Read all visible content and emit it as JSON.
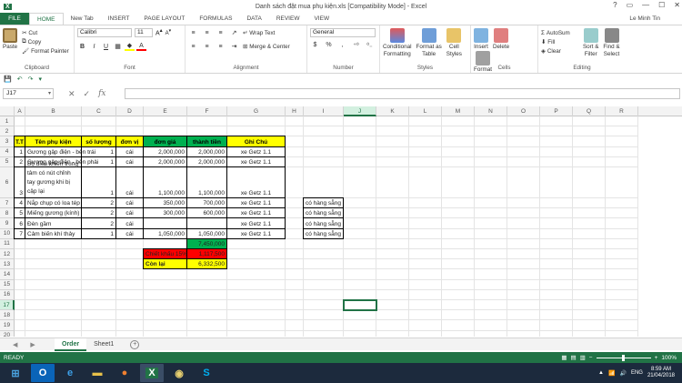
{
  "window": {
    "title": "Danh sách đặt mua phụ kiện.xls  [Compatibility Mode] - Excel",
    "controls": [
      "?",
      "▭",
      "—",
      "☐",
      "✕"
    ]
  },
  "tabs": [
    "FILE",
    "HOME",
    "New Tab",
    "INSERT",
    "PAGE LAYOUT",
    "FORMULAS",
    "DATA",
    "REVIEW",
    "VIEW"
  ],
  "active_tab": "HOME",
  "user": "Le Minh Tin",
  "ribbon": {
    "clipboard": {
      "paste": "Paste",
      "cut": "Cut",
      "copy": "Copy",
      "format_painter": "Format Painter",
      "label": "Clipboard"
    },
    "font": {
      "name": "Calibri",
      "size": "11",
      "label": "Font",
      "bold": "B",
      "italic": "I",
      "underline": "U"
    },
    "alignment": {
      "wrap": "Wrap Text",
      "merge": "Merge & Center",
      "label": "Alignment"
    },
    "number": {
      "format": "General",
      "label": "Number",
      "dollar": "$",
      "percent": "%",
      "comma": ","
    },
    "styles": {
      "conditional": "Conditional\nFormatting",
      "format_table": "Format as\nTable",
      "cell_styles": "Cell\nStyles",
      "label": "Styles"
    },
    "cells": {
      "insert": "Insert",
      "delete": "Delete",
      "format": "Format",
      "label": "Cells"
    },
    "editing": {
      "autosum": "AutoSum",
      "fill": "Fill",
      "clear": "Clear",
      "sort": "Sort &\nFilter",
      "find": "Find &\nSelect",
      "label": "Editing"
    }
  },
  "namebox": "J17",
  "formula_icons": [
    "✕",
    "✓",
    "fx"
  ],
  "columns": [
    "A",
    "B",
    "C",
    "D",
    "E",
    "F",
    "G",
    "H",
    "I",
    "J",
    "K",
    "L",
    "M",
    "N",
    "O",
    "P",
    "Q",
    "R"
  ],
  "selected_col": "J",
  "selected_row": "17",
  "rows": [
    "1",
    "2",
    "3",
    "4",
    "5",
    "6",
    "7",
    "8",
    "9",
    "10",
    "11",
    "12",
    "13",
    "14",
    "15",
    "16",
    "17",
    "18",
    "19",
    "20"
  ],
  "table": {
    "headers": [
      "T.T",
      "Tên phụ kiện",
      "số lượng",
      "đơn vị",
      "đơn giá",
      "thành tiền",
      "Ghi Chú"
    ],
    "items": [
      {
        "tt": "1",
        "name": "Gương gập điện - bên trái",
        "qty": "1",
        "unit": "cái",
        "price": "2,000,000",
        "total": "2,000,000",
        "note": "xe Getz 1.1",
        "extra": ""
      },
      {
        "tt": "2",
        "name": "Gương gập điện - bên phải",
        "qty": "1",
        "unit": "cái",
        "price": "2,000,000",
        "total": "2,000,000",
        "note": "xe Getz 1.1",
        "extra": ""
      },
      {
        "tt": "3",
        "name": "Bộ điều khiển trung tâm có nút chỉnh tay gương khi bị cập lại",
        "qty": "1",
        "unit": "cái",
        "price": "1,100,000",
        "total": "1,100,000",
        "note": "xe Getz 1.1",
        "extra": ""
      },
      {
        "tt": "4",
        "name": "Nắp chụp có loa tép",
        "qty": "2",
        "unit": "cái",
        "price": "350,000",
        "total": "700,000",
        "note": "xe Getz 1.1",
        "extra": "có hàng sẵng"
      },
      {
        "tt": "5",
        "name": "Miếng gương (kính)",
        "qty": "2",
        "unit": "cái",
        "price": "300,000",
        "total": "600,000",
        "note": "xe Getz 1.1",
        "extra": "có hàng sẵng"
      },
      {
        "tt": "6",
        "name": "Đèn gầm",
        "qty": "2",
        "unit": "cái",
        "price": "",
        "total": "",
        "note": "xe Getz 1.1",
        "extra": "có hàng sẵng"
      },
      {
        "tt": "7",
        "name": "Cảm biến khí thảy",
        "qty": "1",
        "unit": "cái",
        "price": "1,050,000",
        "total": "1,050,000",
        "note": "xe Getz 1.1",
        "extra": "có hàng sẵng"
      }
    ],
    "sum_total": "7,450,000",
    "discount_label": "Chiết khấu 15%",
    "discount_value": "1,117,500",
    "remain_label": "Còn lại",
    "remain_value": "6,332,500"
  },
  "sheets": [
    "Order",
    "Sheet1"
  ],
  "active_sheet": "Order",
  "status": {
    "mode": "READY",
    "zoom": "100%"
  },
  "taskbar": {
    "apps": [
      "outlook",
      "ie",
      "explorer",
      "firefox",
      "excel",
      "paint",
      "skype"
    ],
    "lang": "ENG",
    "time": "8:59 AM",
    "date": "21/04/2018"
  },
  "colors": {
    "excel_green": "#217346",
    "header_yellow": "#ffff00",
    "header_green": "#00b050",
    "discount_red": "#ff0000"
  }
}
